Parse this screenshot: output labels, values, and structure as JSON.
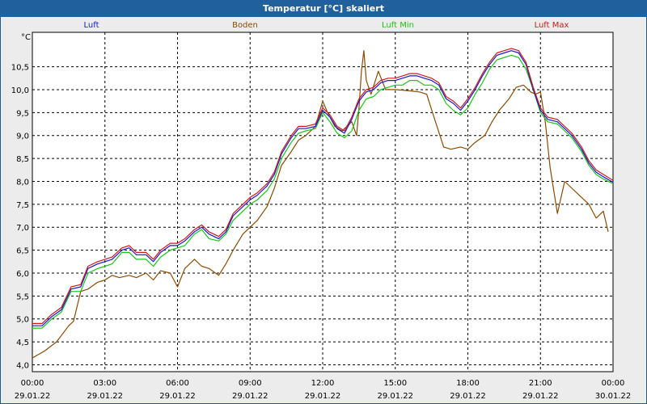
{
  "window": {
    "title": "Temperatur [°C] skaliert"
  },
  "chart_data": {
    "type": "line",
    "title": "Temperatur [°C] skaliert",
    "ylabel": "°C",
    "ylim": [
      3.85,
      11.25
    ],
    "xlim": [
      0,
      24
    ],
    "grid": true,
    "legend_placement": "top",
    "y_ticks": [
      "4,0",
      "4,5",
      "5,0",
      "5,5",
      "6,0",
      "6,5",
      "7,0",
      "7,5",
      "8,0",
      "8,5",
      "9,0",
      "9,5",
      "10,0",
      "10,5"
    ],
    "y_tick_values": [
      4.0,
      4.5,
      5.0,
      5.5,
      6.0,
      6.5,
      7.0,
      7.5,
      8.0,
      8.5,
      9.0,
      9.5,
      10.0,
      10.5
    ],
    "x_tick_times": [
      "00:00",
      "03:00",
      "06:00",
      "09:00",
      "12:00",
      "15:00",
      "18:00",
      "21:00",
      "00:00"
    ],
    "x_tick_dates": [
      "29.01.22",
      "29.01.22",
      "29.01.22",
      "29.01.22",
      "29.01.22",
      "29.01.22",
      "29.01.22",
      "29.01.22",
      "30.01.22"
    ],
    "x_tick_hours": [
      0,
      3,
      6,
      9,
      12,
      15,
      18,
      21,
      24
    ],
    "series": [
      {
        "name": "Boden",
        "color": "#8b4a00",
        "x": [
          0,
          0.5,
          1,
          1.5,
          1.7,
          2.0,
          2.3,
          2.7,
          3.0,
          3.3,
          3.6,
          4.0,
          4.3,
          4.7,
          5.0,
          5.3,
          5.7,
          6.0,
          6.3,
          6.7,
          7.0,
          7.3,
          7.7,
          8.0,
          8.3,
          8.7,
          9.0,
          9.3,
          9.7,
          10.0,
          10.3,
          10.7,
          11.0,
          11.3,
          11.7,
          12.0,
          12.2,
          12.5,
          12.8,
          13.0,
          13.2,
          13.4,
          13.5,
          13.6,
          13.7,
          13.8,
          14.0,
          14.3,
          14.6,
          15.0,
          15.5,
          16.0,
          16.3,
          16.6,
          17.0,
          17.3,
          17.7,
          18.0,
          18.3,
          18.7,
          19.0,
          19.3,
          19.7,
          20.0,
          20.3,
          20.6,
          20.8,
          21.0,
          21.2,
          21.4,
          21.7,
          22.0,
          22.3,
          22.7,
          23.0,
          23.3,
          23.6,
          23.8
        ],
        "y": [
          4.15,
          4.3,
          4.5,
          4.85,
          4.95,
          5.6,
          5.65,
          5.8,
          5.85,
          5.95,
          5.9,
          5.95,
          5.9,
          6.0,
          5.85,
          6.05,
          6.0,
          5.7,
          6.1,
          6.3,
          6.15,
          6.1,
          5.95,
          6.2,
          6.5,
          6.85,
          7.0,
          7.15,
          7.45,
          7.85,
          8.35,
          8.65,
          8.9,
          9.0,
          9.2,
          9.75,
          9.5,
          9.2,
          9.1,
          9.2,
          9.3,
          9.0,
          9.6,
          10.4,
          10.85,
          10.2,
          9.9,
          10.4,
          10.0,
          10.0,
          9.98,
          9.95,
          9.9,
          9.4,
          8.75,
          8.7,
          8.75,
          8.7,
          8.85,
          9.0,
          9.3,
          9.55,
          9.8,
          10.05,
          10.1,
          9.95,
          9.9,
          9.95,
          9.3,
          8.3,
          7.3,
          8.0,
          7.85,
          7.65,
          7.5,
          7.2,
          7.35,
          6.9
        ]
      },
      {
        "name": "Luft Min",
        "color": "#18c418",
        "x": [
          0,
          0.4,
          0.8,
          1.2,
          1.6,
          2.0,
          2.3,
          2.7,
          3.0,
          3.3,
          3.7,
          4.0,
          4.3,
          4.7,
          5.0,
          5.3,
          5.7,
          6.0,
          6.3,
          6.7,
          7.0,
          7.3,
          7.7,
          8.0,
          8.3,
          8.7,
          9.0,
          9.3,
          9.7,
          10.0,
          10.3,
          10.7,
          11.0,
          11.3,
          11.7,
          12.0,
          12.3,
          12.6,
          12.9,
          13.2,
          13.5,
          13.8,
          14.1,
          14.4,
          14.7,
          15.0,
          15.3,
          15.6,
          15.9,
          16.2,
          16.5,
          16.8,
          17.1,
          17.4,
          17.7,
          18.0,
          18.3,
          18.6,
          18.9,
          19.2,
          19.5,
          19.8,
          20.1,
          20.4,
          20.7,
          21.0,
          21.3,
          21.7,
          22.0,
          22.3,
          22.7,
          23.0,
          23.3,
          23.6,
          24.0
        ],
        "y": [
          4.8,
          4.8,
          5.0,
          5.15,
          5.6,
          5.6,
          6.0,
          6.1,
          6.15,
          6.2,
          6.45,
          6.45,
          6.3,
          6.3,
          6.15,
          6.35,
          6.5,
          6.55,
          6.6,
          6.85,
          6.95,
          6.75,
          6.7,
          6.85,
          7.15,
          7.35,
          7.5,
          7.6,
          7.8,
          8.05,
          8.5,
          8.85,
          9.05,
          9.1,
          9.15,
          9.5,
          9.3,
          9.05,
          8.95,
          9.1,
          9.55,
          9.8,
          9.85,
          10.0,
          10.05,
          10.1,
          10.1,
          10.2,
          10.2,
          10.1,
          10.1,
          10.0,
          9.7,
          9.55,
          9.45,
          9.6,
          9.9,
          10.15,
          10.45,
          10.65,
          10.7,
          10.75,
          10.7,
          10.45,
          10.0,
          9.5,
          9.3,
          9.25,
          9.1,
          8.95,
          8.65,
          8.35,
          8.15,
          8.05,
          7.95
        ]
      },
      {
        "name": "Luft",
        "color": "#1818d0",
        "x": [
          0,
          0.4,
          0.8,
          1.2,
          1.6,
          2.0,
          2.3,
          2.7,
          3.0,
          3.3,
          3.7,
          4.0,
          4.3,
          4.7,
          5.0,
          5.3,
          5.7,
          6.0,
          6.3,
          6.7,
          7.0,
          7.3,
          7.7,
          8.0,
          8.3,
          8.7,
          9.0,
          9.3,
          9.7,
          10.0,
          10.3,
          10.7,
          11.0,
          11.3,
          11.7,
          12.0,
          12.3,
          12.6,
          12.9,
          13.2,
          13.5,
          13.8,
          14.1,
          14.4,
          14.7,
          15.0,
          15.3,
          15.6,
          15.9,
          16.2,
          16.5,
          16.8,
          17.1,
          17.4,
          17.7,
          18.0,
          18.3,
          18.6,
          18.9,
          19.2,
          19.5,
          19.8,
          20.1,
          20.4,
          20.7,
          21.0,
          21.3,
          21.7,
          22.0,
          22.3,
          22.7,
          23.0,
          23.3,
          23.6,
          24.0
        ],
        "y": [
          4.85,
          4.85,
          5.05,
          5.2,
          5.65,
          5.7,
          6.1,
          6.2,
          6.25,
          6.3,
          6.5,
          6.55,
          6.4,
          6.4,
          6.25,
          6.45,
          6.6,
          6.6,
          6.7,
          6.9,
          7.0,
          6.85,
          6.75,
          6.9,
          7.25,
          7.45,
          7.6,
          7.7,
          7.9,
          8.15,
          8.6,
          8.95,
          9.15,
          9.15,
          9.2,
          9.55,
          9.4,
          9.15,
          9.05,
          9.35,
          9.75,
          9.95,
          10.0,
          10.15,
          10.2,
          10.2,
          10.25,
          10.3,
          10.3,
          10.25,
          10.2,
          10.1,
          9.8,
          9.7,
          9.55,
          9.75,
          10.0,
          10.3,
          10.55,
          10.75,
          10.8,
          10.85,
          10.8,
          10.55,
          10.0,
          9.55,
          9.35,
          9.3,
          9.15,
          9.0,
          8.7,
          8.4,
          8.2,
          8.1,
          7.98
        ]
      },
      {
        "name": "Luft Max",
        "color": "#d01818",
        "x": [
          0,
          0.4,
          0.8,
          1.2,
          1.6,
          2.0,
          2.3,
          2.7,
          3.0,
          3.3,
          3.7,
          4.0,
          4.3,
          4.7,
          5.0,
          5.3,
          5.7,
          6.0,
          6.3,
          6.7,
          7.0,
          7.3,
          7.7,
          8.0,
          8.3,
          8.7,
          9.0,
          9.3,
          9.7,
          10.0,
          10.3,
          10.7,
          11.0,
          11.3,
          11.7,
          12.0,
          12.3,
          12.6,
          12.9,
          13.2,
          13.5,
          13.8,
          14.1,
          14.4,
          14.7,
          15.0,
          15.3,
          15.6,
          15.9,
          16.2,
          16.5,
          16.8,
          17.1,
          17.4,
          17.7,
          18.0,
          18.3,
          18.6,
          18.9,
          19.2,
          19.5,
          19.8,
          20.1,
          20.4,
          20.7,
          21.0,
          21.3,
          21.7,
          22.0,
          22.3,
          22.7,
          23.0,
          23.3,
          23.6,
          24.0
        ],
        "y": [
          4.9,
          4.9,
          5.1,
          5.25,
          5.7,
          5.75,
          6.15,
          6.25,
          6.3,
          6.35,
          6.55,
          6.6,
          6.45,
          6.45,
          6.3,
          6.5,
          6.65,
          6.65,
          6.75,
          6.95,
          7.05,
          6.9,
          6.8,
          6.95,
          7.3,
          7.5,
          7.65,
          7.75,
          7.95,
          8.2,
          8.65,
          9.0,
          9.2,
          9.2,
          9.25,
          9.6,
          9.45,
          9.2,
          9.1,
          9.4,
          9.8,
          10.0,
          10.05,
          10.2,
          10.25,
          10.25,
          10.3,
          10.35,
          10.35,
          10.3,
          10.25,
          10.15,
          9.85,
          9.75,
          9.6,
          9.8,
          10.05,
          10.35,
          10.6,
          10.8,
          10.85,
          10.9,
          10.85,
          10.6,
          10.05,
          9.6,
          9.4,
          9.35,
          9.2,
          9.05,
          8.75,
          8.45,
          8.25,
          8.15,
          8.02
        ]
      }
    ]
  }
}
